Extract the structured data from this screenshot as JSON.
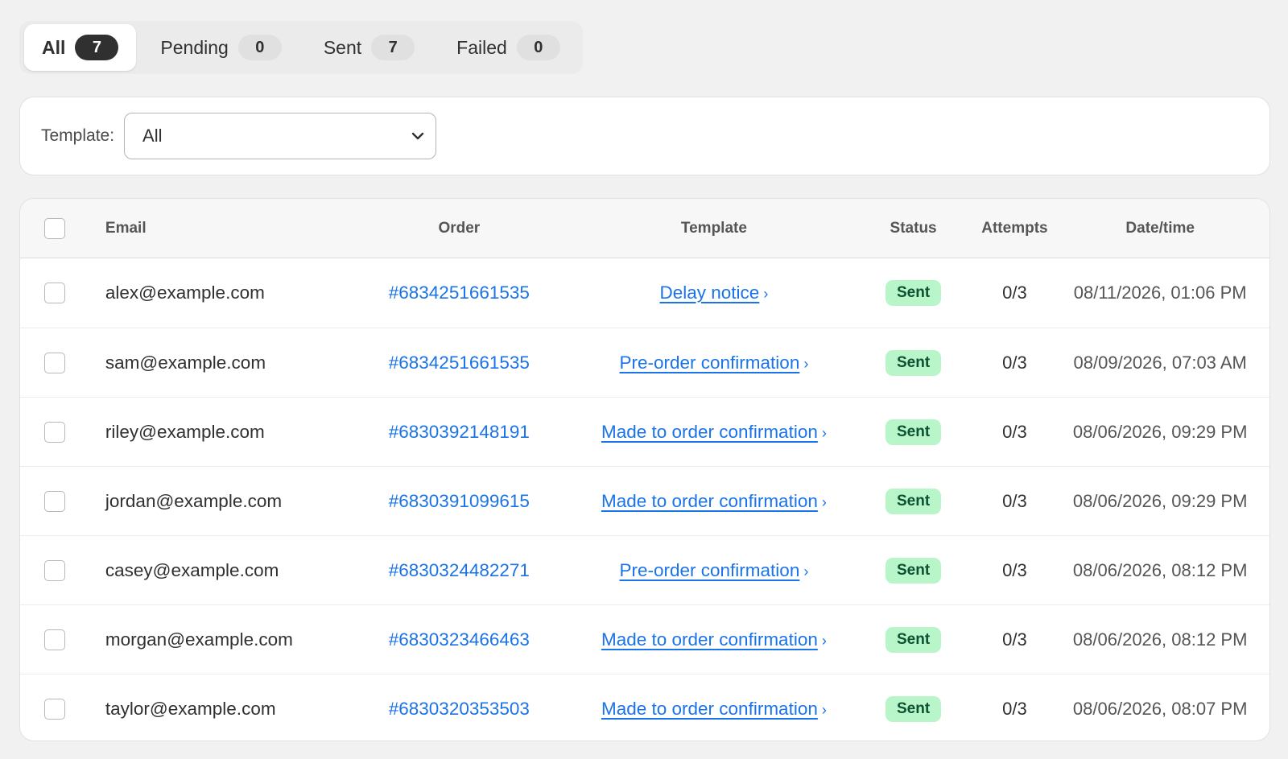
{
  "tabs": [
    {
      "label": "All",
      "count": "7"
    },
    {
      "label": "Pending",
      "count": "0"
    },
    {
      "label": "Sent",
      "count": "7"
    },
    {
      "label": "Failed",
      "count": "0"
    }
  ],
  "filter": {
    "label": "Template:",
    "value": "All"
  },
  "table": {
    "headers": {
      "email": "Email",
      "order": "Order",
      "template": "Template",
      "status": "Status",
      "attempts": "Attempts",
      "datetime": "Date/time"
    },
    "rows": [
      {
        "email": "alex@example.com",
        "order": "#6834251661535",
        "template": "Delay notice",
        "status": "Sent",
        "attempts": "0/3",
        "datetime": "08/11/2026, 01:06 PM"
      },
      {
        "email": "sam@example.com",
        "order": "#6834251661535",
        "template": "Pre-order confirmation",
        "status": "Sent",
        "attempts": "0/3",
        "datetime": "08/09/2026, 07:03 AM"
      },
      {
        "email": "riley@example.com",
        "order": "#6830392148191",
        "template": "Made to order confirmation",
        "status": "Sent",
        "attempts": "0/3",
        "datetime": "08/06/2026, 09:29 PM"
      },
      {
        "email": "jordan@example.com",
        "order": "#6830391099615",
        "template": "Made to order confirmation",
        "status": "Sent",
        "attempts": "0/3",
        "datetime": "08/06/2026, 09:29 PM"
      },
      {
        "email": "casey@example.com",
        "order": "#6830324482271",
        "template": "Pre-order confirmation",
        "status": "Sent",
        "attempts": "0/3",
        "datetime": "08/06/2026, 08:12 PM"
      },
      {
        "email": "morgan@example.com",
        "order": "#6830323466463",
        "template": "Made to order confirmation",
        "status": "Sent",
        "attempts": "0/3",
        "datetime": "08/06/2026, 08:12 PM"
      },
      {
        "email": "taylor@example.com",
        "order": "#6830320353503",
        "template": "Made to order confirmation",
        "status": "Sent",
        "attempts": "0/3",
        "datetime": "08/06/2026, 08:07 PM"
      }
    ]
  },
  "icons": {
    "template_link": "chevron-right-icon",
    "select": "chevron-down-icon"
  },
  "colors": {
    "link": "#1a73e8",
    "status_sent_bg": "#b8f5c8",
    "status_sent_text": "#0c5132",
    "active_count_bg": "#303030"
  }
}
